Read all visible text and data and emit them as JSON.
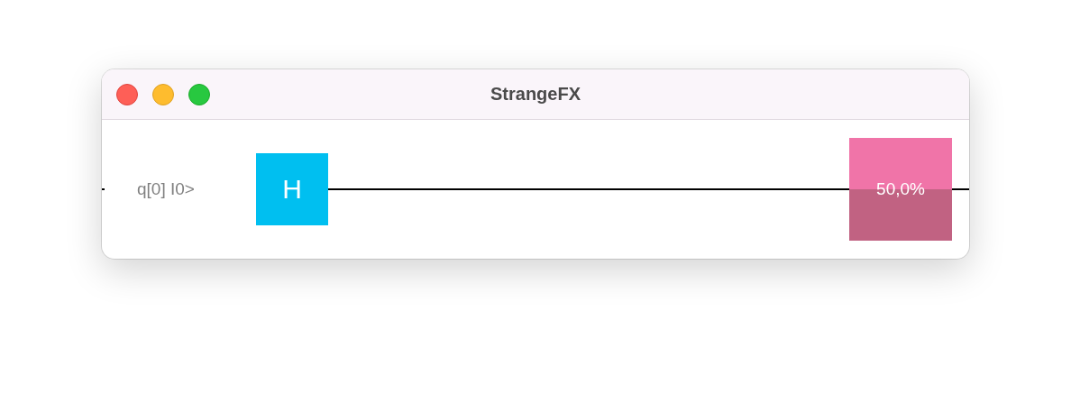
{
  "window": {
    "title": "StrangeFX"
  },
  "qubits": [
    {
      "label": "q[0] I0>",
      "gates": [
        {
          "kind": "gate",
          "symbol": "H"
        }
      ],
      "measurement": {
        "reading": "50,0%"
      }
    }
  ]
}
